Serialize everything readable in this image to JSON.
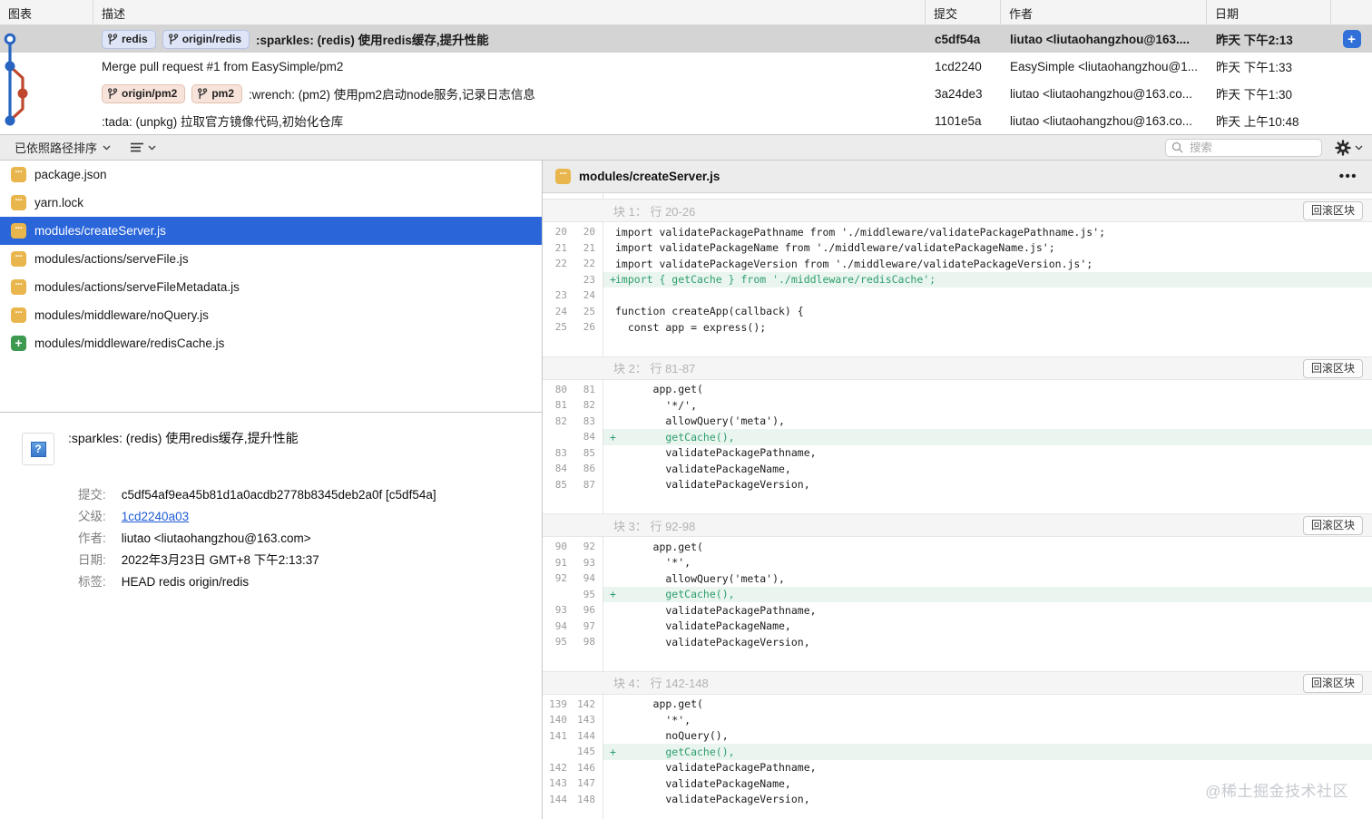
{
  "colors": {
    "graph_blue": "#2765c0",
    "graph_red": "#bf472e",
    "selected_row_gray": "#d4d4d5",
    "selected_file_blue": "#2a66d9",
    "added_line_text": "#2e9e6f",
    "added_line_bg": "#e9f5ee",
    "tag_blue_bg": "#dee5f6",
    "tag_orange_bg": "#f8e3da",
    "icon_modified_orange": "#e9b64d",
    "icon_added_green": "#3d9a50",
    "add_button_blue": "#3070d8",
    "link_blue": "#1f5bd4"
  },
  "icons": {
    "modified_glyph": "···",
    "added_glyph": "+",
    "more_glyph": "•••",
    "avatar_glyph": "?",
    "add_button_glyph": "+"
  },
  "commit_table": {
    "columns": [
      "图表",
      "描述",
      "提交",
      "作者",
      "日期",
      ""
    ],
    "rows": [
      {
        "refs": [
          {
            "label": "redis",
            "type": "blue"
          },
          {
            "label": "origin/redis",
            "type": "blue"
          }
        ],
        "message": ":sparkles: (redis) 使用redis缓存,提升性能",
        "hash": "c5df54a",
        "author": "liutao <liutaohangzhou@163....",
        "date": "昨天 下午2:13",
        "selected": true,
        "has_add_button": true
      },
      {
        "refs": [],
        "message": "Merge pull request #1 from EasySimple/pm2",
        "hash": "1cd2240",
        "author": "EasySimple <liutaohangzhou@1...",
        "date": "昨天 下午1:33",
        "selected": false,
        "has_add_button": false
      },
      {
        "refs": [
          {
            "label": "origin/pm2",
            "type": "orange"
          },
          {
            "label": "pm2",
            "type": "orange"
          }
        ],
        "message": ":wrench: (pm2) 使用pm2启动node服务,记录日志信息",
        "hash": "3a24de3",
        "author": "liutao <liutaohangzhou@163.co...",
        "date": "昨天 下午1:30",
        "selected": false,
        "has_add_button": false
      },
      {
        "refs": [],
        "message": ":tada: (unpkg) 拉取官方镜像代码,初始化仓库",
        "hash": "1101e5a",
        "author": "liutao <liutaohangzhou@163.co...",
        "date": "昨天 上午10:48",
        "selected": false,
        "has_add_button": false
      }
    ]
  },
  "toolbar": {
    "sort_label": "已依照路径排序",
    "search_placeholder": "搜索"
  },
  "file_list": [
    {
      "path": "package.json",
      "status": "modified",
      "selected": false
    },
    {
      "path": "yarn.lock",
      "status": "modified",
      "selected": false
    },
    {
      "path": "modules/createServer.js",
      "status": "modified",
      "selected": true
    },
    {
      "path": "modules/actions/serveFile.js",
      "status": "modified",
      "selected": false
    },
    {
      "path": "modules/actions/serveFileMetadata.js",
      "status": "modified",
      "selected": false
    },
    {
      "path": "modules/middleware/noQuery.js",
      "status": "modified",
      "selected": false
    },
    {
      "path": "modules/middleware/redisCache.js",
      "status": "added",
      "selected": false
    }
  ],
  "commit_details": {
    "message": ":sparkles: (redis) 使用redis缓存,提升性能",
    "fields": [
      {
        "label": "提交:",
        "value": "c5df54af9ea45b81d1a0acdb2778b8345deb2a0f [c5df54a]",
        "link": false
      },
      {
        "label": "父级:",
        "value": "1cd2240a03",
        "link": true
      },
      {
        "label": "作者:",
        "value": "liutao <liutaohangzhou@163.com>",
        "link": false
      },
      {
        "label": "日期:",
        "value": "2022年3月23日 GMT+8 下午2:13:37",
        "link": false
      },
      {
        "label": "标签:",
        "value": "HEAD redis origin/redis",
        "link": false
      }
    ]
  },
  "diff": {
    "file": "modules/createServer.js",
    "rollback_label": "回滚区块",
    "hunks": [
      {
        "title": "块 1： 行 20-26",
        "lines": [
          {
            "old": "20",
            "new": "20",
            "added": false,
            "text": "import validatePackagePathname from './middleware/validatePackagePathname.js';"
          },
          {
            "old": "21",
            "new": "21",
            "added": false,
            "text": "import validatePackageName from './middleware/validatePackageName.js';"
          },
          {
            "old": "22",
            "new": "22",
            "added": false,
            "text": "import validatePackageVersion from './middleware/validatePackageVersion.js';"
          },
          {
            "old": "",
            "new": "23",
            "added": true,
            "text": "import { getCache } from './middleware/redisCache';"
          },
          {
            "old": "23",
            "new": "24",
            "added": false,
            "text": ""
          },
          {
            "old": "24",
            "new": "25",
            "added": false,
            "text": "function createApp(callback) {"
          },
          {
            "old": "25",
            "new": "26",
            "added": false,
            "text": "  const app = express();"
          }
        ]
      },
      {
        "title": "块 2： 行 81-87",
        "lines": [
          {
            "old": "80",
            "new": "81",
            "added": false,
            "text": "      app.get("
          },
          {
            "old": "81",
            "new": "82",
            "added": false,
            "text": "        '*/',"
          },
          {
            "old": "82",
            "new": "83",
            "added": false,
            "text": "        allowQuery('meta'),"
          },
          {
            "old": "",
            "new": "84",
            "added": true,
            "text": "        getCache(),"
          },
          {
            "old": "83",
            "new": "85",
            "added": false,
            "text": "        validatePackagePathname,"
          },
          {
            "old": "84",
            "new": "86",
            "added": false,
            "text": "        validatePackageName,"
          },
          {
            "old": "85",
            "new": "87",
            "added": false,
            "text": "        validatePackageVersion,"
          }
        ]
      },
      {
        "title": "块 3： 行 92-98",
        "lines": [
          {
            "old": "90",
            "new": "92",
            "added": false,
            "text": "      app.get("
          },
          {
            "old": "91",
            "new": "93",
            "added": false,
            "text": "        '*',"
          },
          {
            "old": "92",
            "new": "94",
            "added": false,
            "text": "        allowQuery('meta'),"
          },
          {
            "old": "",
            "new": "95",
            "added": true,
            "text": "        getCache(),"
          },
          {
            "old": "93",
            "new": "96",
            "added": false,
            "text": "        validatePackagePathname,"
          },
          {
            "old": "94",
            "new": "97",
            "added": false,
            "text": "        validatePackageName,"
          },
          {
            "old": "95",
            "new": "98",
            "added": false,
            "text": "        validatePackageVersion,"
          }
        ]
      },
      {
        "title": "块 4： 行 142-148",
        "lines": [
          {
            "old": "139",
            "new": "142",
            "added": false,
            "text": "      app.get("
          },
          {
            "old": "140",
            "new": "143",
            "added": false,
            "text": "        '*',"
          },
          {
            "old": "141",
            "new": "144",
            "added": false,
            "text": "        noQuery(),"
          },
          {
            "old": "",
            "new": "145",
            "added": true,
            "text": "        getCache(),"
          },
          {
            "old": "142",
            "new": "146",
            "added": false,
            "text": "        validatePackagePathname,"
          },
          {
            "old": "143",
            "new": "147",
            "added": false,
            "text": "        validatePackageName,"
          },
          {
            "old": "144",
            "new": "148",
            "added": false,
            "text": "        validatePackageVersion,"
          }
        ]
      }
    ]
  },
  "watermark": "@稀土掘金技术社区"
}
